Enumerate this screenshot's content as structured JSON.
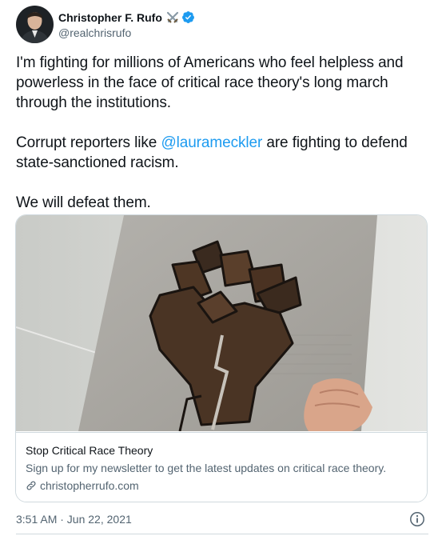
{
  "author": {
    "display_name": "Christopher F. Rufo",
    "handle": "@realchrisrufo",
    "emoji": "crossed-swords",
    "verified": true
  },
  "tweet": {
    "line1": "I'm fighting for millions of Americans who feel helpless and powerless in the face of critical race theory's long march through the institutions.",
    "line2_before": "Corrupt reporters like ",
    "line2_mention": "@laurameckler",
    "line2_after": " are fighting to defend state-sanctioned racism.",
    "line3": "We will defeat them."
  },
  "card": {
    "image": "raised-fist-drawing-on-paper",
    "title": "Stop Critical Race Theory",
    "description": "Sign up for my newsletter to get the latest updates on critical race theory.",
    "domain": "christopherrufo.com"
  },
  "footer": {
    "timestamp": "3:51 AM · Jun 22, 2021",
    "info_icon": "info-icon"
  },
  "colors": {
    "link": "#1d9bf0",
    "text": "#0f1419",
    "secondary": "#536471",
    "border": "#cfd9de",
    "verified": "#1d9bf0"
  }
}
